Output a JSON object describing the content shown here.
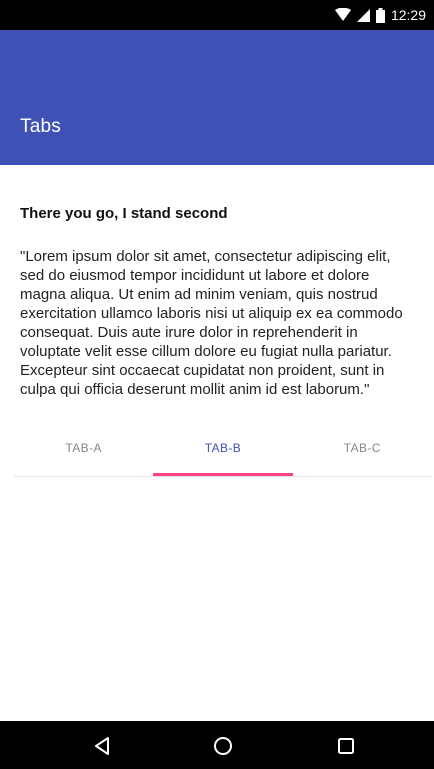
{
  "status_bar": {
    "time": "12:29",
    "icons": [
      "wifi-icon",
      "signal-icon",
      "battery-icon"
    ]
  },
  "app_bar": {
    "title": "Tabs",
    "color": "#3f51b5"
  },
  "content": {
    "title": "There you go, I stand second",
    "body": "\"Lorem ipsum dolor sit amet, consectetur adipiscing elit, sed do eiusmod tempor incididunt ut labore et dolore magna aliqua. Ut enim ad minim veniam, quis nostrud exercitation ullamco laboris nisi ut aliquip ex ea commodo consequat. Duis aute irure dolor in reprehenderit in voluptate velit esse cillum dolore eu fugiat nulla pariatur. Excepteur sint occaecat cupidatat non proident, sunt in culpa qui officia deserunt mollit anim id est laborum.\""
  },
  "tabs": [
    {
      "label": "TAB-A",
      "active": false
    },
    {
      "label": "TAB-B",
      "active": true
    },
    {
      "label": "TAB-C",
      "active": false
    }
  ],
  "colors": {
    "primary": "#3f51b5",
    "accent": "#ff4081"
  },
  "nav_bar": {
    "icons": [
      "back-icon",
      "home-icon",
      "recents-icon"
    ]
  }
}
